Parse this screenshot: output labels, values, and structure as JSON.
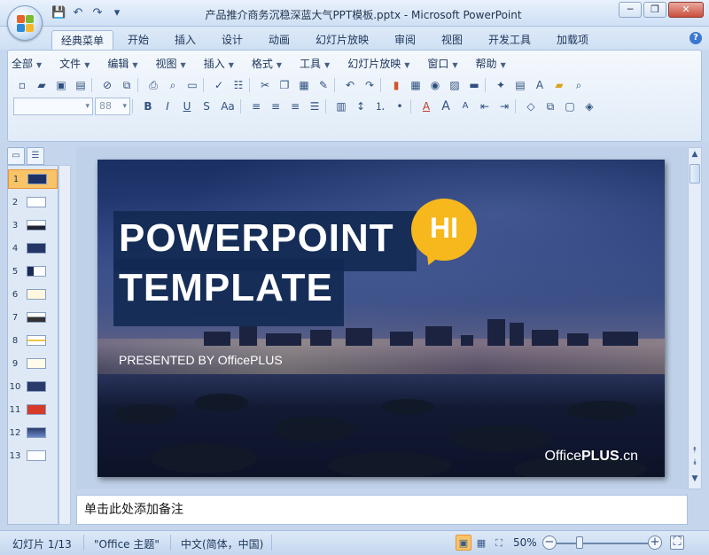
{
  "window": {
    "title": "产品推介商务沉稳深蓝大气PPT模板.pptx - Microsoft PowerPoint",
    "minimize": "─",
    "restore": "❐",
    "close": "✕"
  },
  "quick_access": {
    "save": "💾",
    "undo": "↶",
    "redo": "↷",
    "more": "▾"
  },
  "ribbon_tabs": [
    "经典菜单",
    "开始",
    "插入",
    "设计",
    "动画",
    "幻灯片放映",
    "审阅",
    "视图",
    "开发工具",
    "加载项"
  ],
  "active_tab": "经典菜单",
  "help": "?",
  "menus": [
    "全部",
    "文件",
    "编辑",
    "视图",
    "插入",
    "格式",
    "工具",
    "幻灯片放映",
    "窗口",
    "帮助"
  ],
  "toolbar": {
    "font_name": "",
    "font_size": "88",
    "bold": "B",
    "italic": "I",
    "underline": "U",
    "strike": "S",
    "case": "Aa"
  },
  "thumbnails": [
    "1",
    "2",
    "3",
    "4",
    "5",
    "6",
    "7",
    "8",
    "9",
    "10",
    "11",
    "12",
    "13"
  ],
  "selected_slide": "1",
  "slide": {
    "title_line1": "POWERPOINT",
    "title_line2": "TEMPLATE",
    "badge": "HI",
    "presented_by": "PRESENTED BY OfficePLUS",
    "brand_office": "Office",
    "brand_plus": "PLUS",
    "brand_cn": ".cn"
  },
  "notes_placeholder": "单击此处添加备注",
  "status": {
    "slide_info": "幻灯片 1/13",
    "theme": "\"Office 主题\"",
    "language": "中文(简体，中国)",
    "zoom": "50%",
    "zoom_level_fraction": 0.5
  },
  "colors": {
    "accent_yellow": "#f7b81d",
    "title_box": "#122a52",
    "selection": "#f8c467"
  }
}
